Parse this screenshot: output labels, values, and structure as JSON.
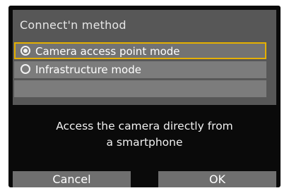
{
  "dialog": {
    "title": "Connect'n method"
  },
  "options": [
    {
      "label": "Camera access point mode",
      "selected": true
    },
    {
      "label": "Infrastructure mode",
      "selected": false
    },
    {
      "label": "",
      "selected": false
    }
  ],
  "description": {
    "line1": "Access the camera directly from",
    "line2": "a smartphone"
  },
  "buttons": {
    "cancel": "Cancel",
    "ok": "OK"
  },
  "colors": {
    "highlight": "#e5b000",
    "screen_bg": "#0a0a0a",
    "panel_bg": "#575757",
    "option_bg": "#7c7c7c",
    "button_bg": "#6f6f6f"
  },
  "icons": {
    "radio_selected": "radio-selected-icon",
    "radio_unselected": "radio-unselected-icon"
  }
}
